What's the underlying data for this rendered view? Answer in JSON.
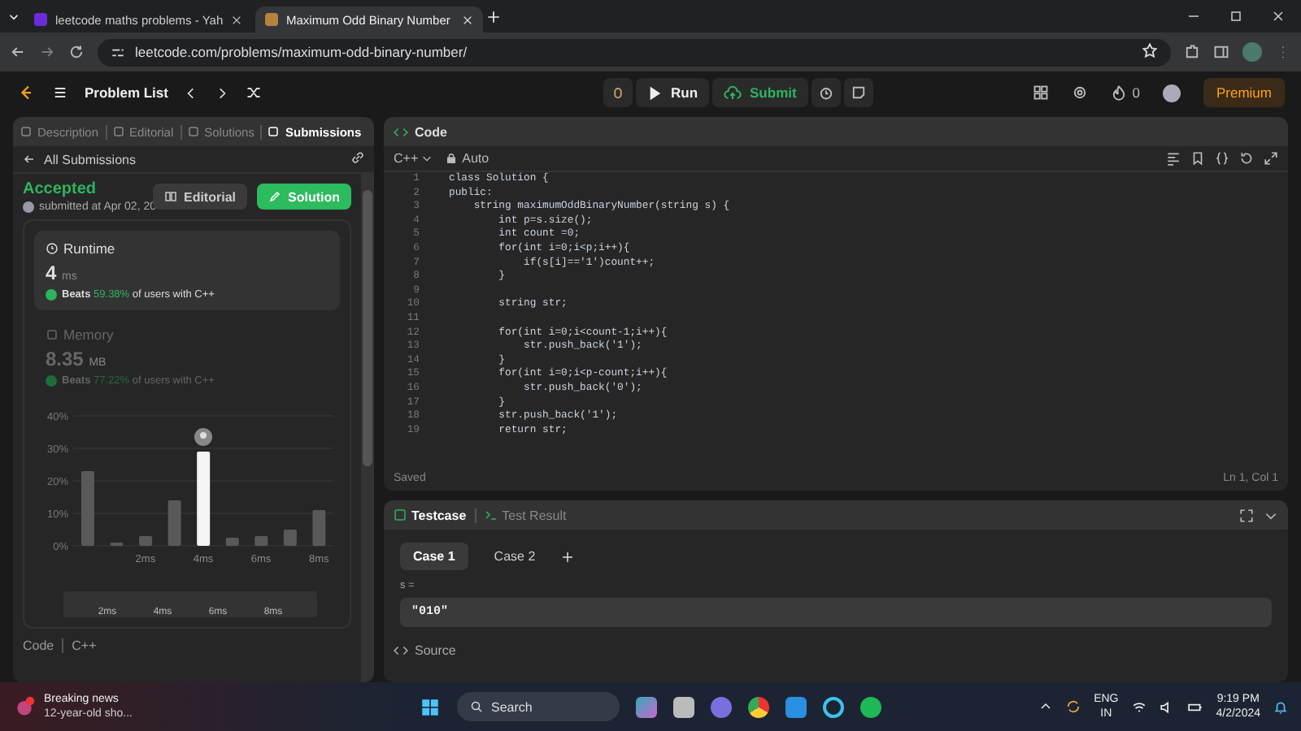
{
  "browser": {
    "tabs": [
      {
        "title": "leetcode maths problems - Yah",
        "selected": false
      },
      {
        "title": "Maximum Odd Binary Number",
        "selected": true
      }
    ],
    "url": "leetcode.com/problems/maximum-odd-binary-number/"
  },
  "nav": {
    "problem_list": "Problem List",
    "run": "Run",
    "submit": "Submit",
    "streak": "0",
    "premium": "Premium"
  },
  "left": {
    "tabs": [
      {
        "label": "Description",
        "selected": false
      },
      {
        "label": "Editorial",
        "selected": false
      },
      {
        "label": "Solutions",
        "selected": false
      },
      {
        "label": "Submissions",
        "selected": true
      }
    ],
    "back": "All Submissions",
    "status": "Accepted",
    "submitted": "submitted at Apr 02, 20",
    "editorial_button": "Editorial",
    "solution_button": "Solution",
    "stats": [
      {
        "title": "Runtime",
        "value": "4",
        "unit": "ms",
        "beats": "Beats",
        "percent": "59.38%",
        "rest": "of users with C++",
        "selected": true
      },
      {
        "title": "Memory",
        "value": "8.35",
        "unit": "MB",
        "beats": "Beats",
        "percent": "77.22%",
        "rest": "of users with C++",
        "selected": false
      }
    ],
    "chart_data": {
      "type": "bar",
      "x": [
        0,
        1,
        2,
        3,
        4,
        5,
        6,
        7,
        8
      ],
      "xlim": [
        -0.5,
        8.5
      ],
      "grid": true,
      "series": [
        {
          "color": "#595959",
          "values": [
            23,
            1,
            3,
            14,
            null,
            2.5,
            3,
            5,
            11
          ]
        },
        {
          "color": "#f5f5f5",
          "values": [
            null,
            null,
            null,
            null,
            29,
            null,
            null,
            null,
            null
          ]
        }
      ],
      "ylim": [
        0,
        40
      ],
      "yticks": [
        {
          "value": 0,
          "label": "0%"
        },
        {
          "value": 10,
          "label": "10%"
        },
        {
          "value": 20,
          "label": "20%"
        },
        {
          "value": 30,
          "label": "30%"
        },
        {
          "value": 40,
          "label": "40%"
        }
      ],
      "xticks": [
        {
          "value": 2,
          "label": "2ms"
        },
        {
          "value": 4,
          "label": "4ms"
        },
        {
          "value": 6,
          "label": "6ms"
        },
        {
          "value": 8,
          "label": "8ms"
        }
      ]
    },
    "navigator_labels": [
      "2ms",
      "4ms",
      "6ms",
      "8ms"
    ],
    "code_label": "Code",
    "code_lang": "C++"
  },
  "editor": {
    "title": "Code",
    "lang": "C++",
    "mode": "Auto",
    "lines": [
      {
        "n": "1",
        "code": "class Solution {"
      },
      {
        "n": "2",
        "code": "public:"
      },
      {
        "n": "3",
        "code": "    string maximumOddBinaryNumber(string s) {"
      },
      {
        "n": "4",
        "code": "        int p=s.size();"
      },
      {
        "n": "5",
        "code": "        int count =0;"
      },
      {
        "n": "6",
        "code": "        for(int i=0;i<p;i++){"
      },
      {
        "n": "7",
        "code": "            if(s[i]=='1')count++;"
      },
      {
        "n": "8",
        "code": "        }"
      },
      {
        "n": "9"
      },
      {
        "n": "10",
        "code": "        string str;"
      },
      {
        "n": "11"
      },
      {
        "n": "12",
        "code": "        for(int i=0;i<count-1;i++){"
      },
      {
        "n": "13",
        "code": "            str.push_back('1');"
      },
      {
        "n": "14",
        "code": "        }"
      },
      {
        "n": "15",
        "code": "        for(int i=0;i<p-count;i++){"
      },
      {
        "n": "16",
        "code": "            str.push_back('0');"
      },
      {
        "n": "17",
        "code": "        }"
      },
      {
        "n": "18",
        "code": "        str.push_back('1');"
      },
      {
        "n": "19",
        "code": "        return str;"
      }
    ],
    "status": "Saved",
    "cursor": "Ln 1, Col 1"
  },
  "testcase": {
    "tabs": [
      {
        "label": "Testcase",
        "selected": true
      },
      {
        "label": "Test Result",
        "selected": false
      }
    ],
    "cases": [
      {
        "label": "Case 1",
        "selected": true
      },
      {
        "label": "Case 2",
        "selected": false
      }
    ],
    "param": "s =",
    "value": "\"010\"",
    "source": "Source"
  },
  "taskbar": {
    "news_title": "Breaking news",
    "news_text": "12-year-old sho...",
    "search": "Search",
    "lang": "ENG",
    "region": "IN",
    "time": "9:19 PM",
    "date": "4/2/2024"
  }
}
